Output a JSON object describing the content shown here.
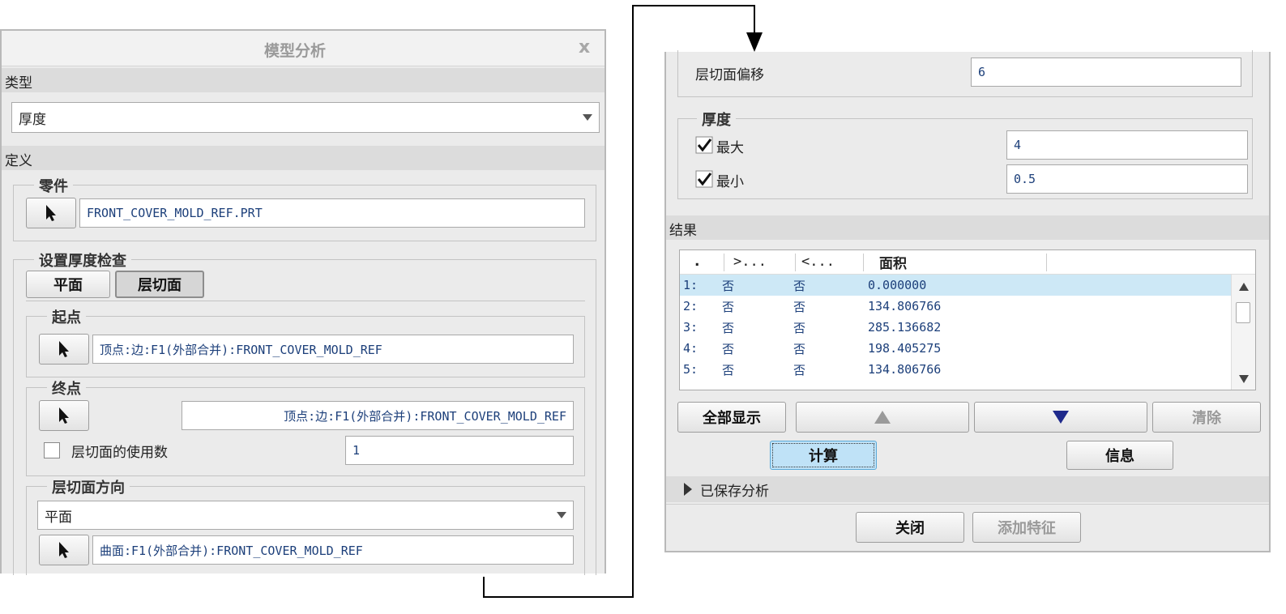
{
  "dialog": {
    "title": "模型分析",
    "close_symbol": "x",
    "type_section": "类型",
    "type_value": "厚度",
    "define_section": "定义",
    "part_group": "零件",
    "part_value": "FRONT_COVER_MOLD_REF.PRT",
    "setup_group": "设置厚度检查",
    "tab_plane": "平面",
    "tab_slices": "层切面",
    "start_group": "起点",
    "start_value": "顶点:边:F1(外部合并):FRONT_COVER_MOLD_REF",
    "end_group": "终点",
    "end_value": "顶点:边:F1(外部合并):FRONT_COVER_MOLD_REF",
    "slice_count_label": "层切面的使用数",
    "slice_count_value": "1",
    "slice_dir_group": "层切面方向",
    "slice_dir_value": "平面",
    "slice_dir_ref": "曲面:F1(外部合并):FRONT_COVER_MOLD_REF"
  },
  "right": {
    "offset_label": "层切面偏移",
    "offset_value": "6",
    "thickness_group": "厚度",
    "max_label": "最大",
    "max_value": "4",
    "min_label": "最小",
    "min_value": "0.5",
    "results_section": "结果",
    "table": {
      "headers": [
        ".",
        ">...",
        "<...",
        "面积"
      ],
      "rows": [
        {
          "idx": "1:",
          "gt": "否",
          "lt": "否",
          "area": "0.000000"
        },
        {
          "idx": "2:",
          "gt": "否",
          "lt": "否",
          "area": "134.806766"
        },
        {
          "idx": "3:",
          "gt": "否",
          "lt": "否",
          "area": "285.136682"
        },
        {
          "idx": "4:",
          "gt": "否",
          "lt": "否",
          "area": "198.405275"
        },
        {
          "idx": "5:",
          "gt": "否",
          "lt": "否",
          "area": "134.806766"
        }
      ]
    },
    "show_all": "全部显示",
    "clear": "清除",
    "compute": "计算",
    "info": "信息",
    "saved_analysis": "已保存分析",
    "close": "关闭",
    "add_feature": "添加特征"
  },
  "colors": {
    "panel": "#ebebeb",
    "header": "#dcdcdc",
    "selected_row": "#cde8f6",
    "value_text": "#1c3f7a",
    "arrow_up": "#9a9a9a",
    "arrow_down": "#1f2a8c"
  }
}
